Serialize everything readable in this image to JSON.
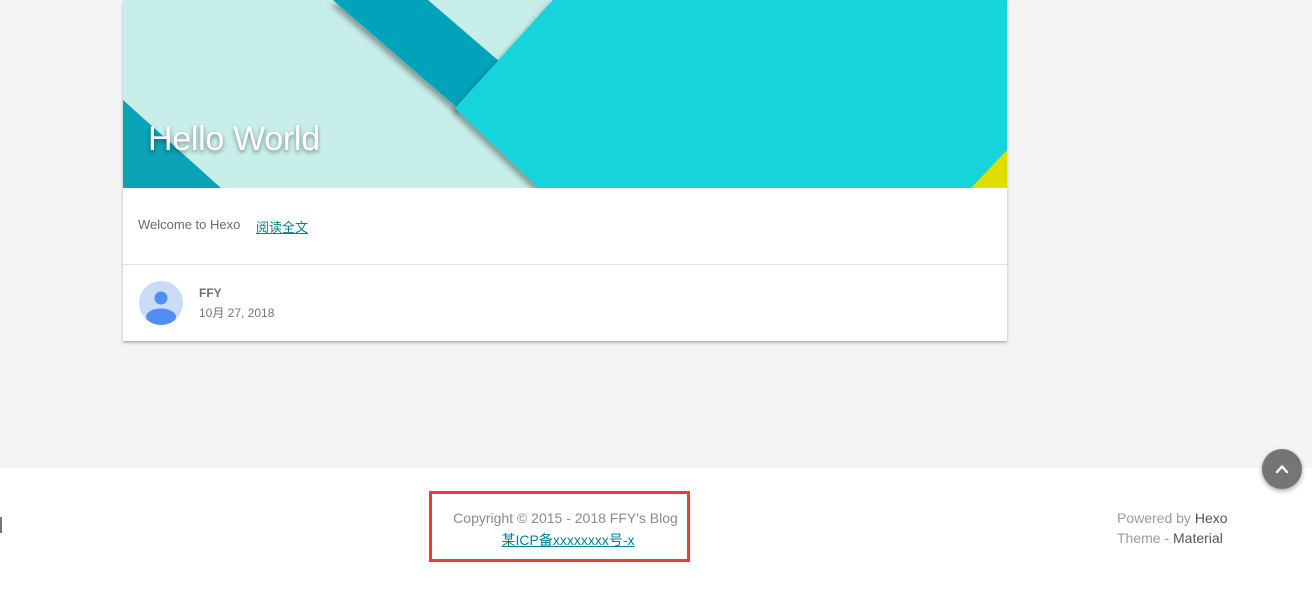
{
  "post": {
    "title": "Hello World",
    "excerpt": "Welcome to Hexo",
    "read_more": "阅读全文",
    "author": "FFY",
    "date": "10月 27, 2018"
  },
  "footer": {
    "copyright": "Copyright © 2015 - 2018 FFY's Blog",
    "icp": "某ICP备xxxxxxxx号-x",
    "powered_prefix": "Powered by ",
    "powered_link": "Hexo",
    "theme_prefix": "Theme - ",
    "theme_link": "Material"
  },
  "colors": {
    "banner_light": "#c8eee9",
    "banner_cyan": "#12d4dc",
    "banner_teal": "#05a3b9",
    "banner_yellow": "#dede00",
    "link": "#00838f",
    "highlight": "#f0393c"
  },
  "icons": {
    "avatar": "person-avatar-icon",
    "back_to_top": "chevron-up-icon"
  }
}
